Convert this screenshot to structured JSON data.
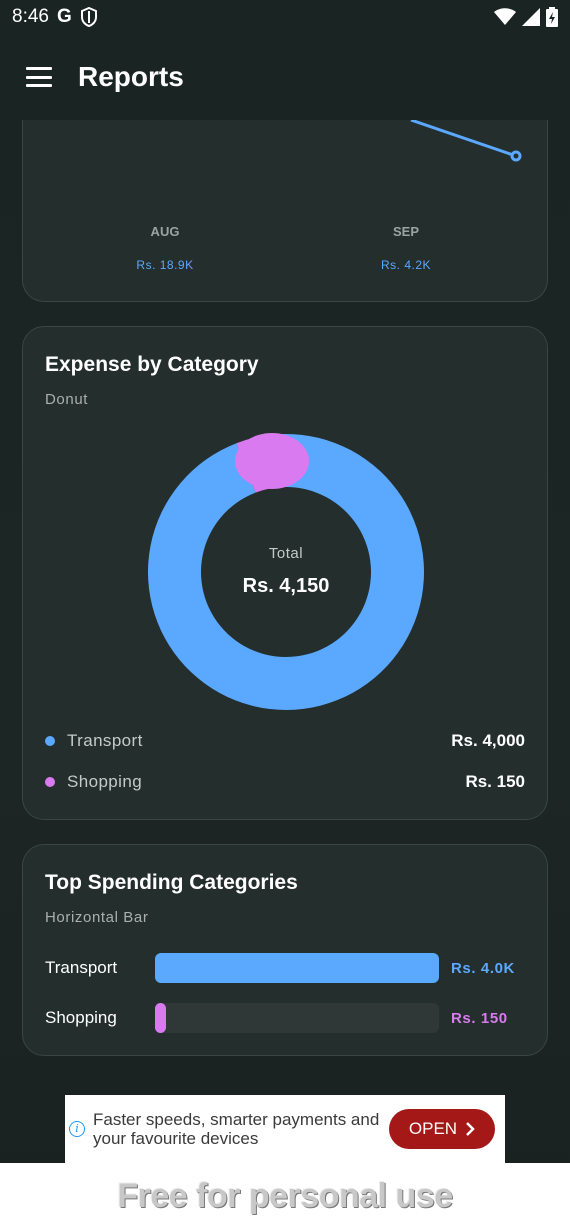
{
  "status_bar": {
    "time": "8:46",
    "g_label": "G"
  },
  "app_bar": {
    "title": "Reports"
  },
  "monthly_chart": {
    "chart_data": {
      "type": "line",
      "categories": [
        "AUG",
        "SEP"
      ],
      "value_labels": [
        "Rs. 18.9K",
        "Rs. 4.2K"
      ],
      "values": [
        18900,
        4200
      ],
      "xlabel": "",
      "ylabel": ""
    }
  },
  "expense_by_category": {
    "title": "Expense by Category",
    "subtitle": "Donut",
    "center_label": "Total",
    "center_value": "Rs. 4,150",
    "chart_data": {
      "type": "pie",
      "categories": [
        "Transport",
        "Shopping"
      ],
      "values": [
        4000,
        150
      ],
      "colors": [
        "#5aa8ff",
        "#d97af0"
      ]
    },
    "legend": [
      {
        "label": "Transport",
        "value": "Rs. 4,000",
        "color": "#5aa8ff"
      },
      {
        "label": "Shopping",
        "value": "Rs. 150",
        "color": "#d97af0"
      }
    ]
  },
  "top_spending": {
    "title": "Top Spending Categories",
    "subtitle": "Horizontal Bar",
    "chart_data": {
      "type": "bar",
      "orientation": "horizontal",
      "categories": [
        "Transport",
        "Shopping"
      ],
      "values": [
        4000,
        150
      ],
      "colors": [
        "#5aa8ff",
        "#d97af0"
      ]
    },
    "bars": [
      {
        "label": "Transport",
        "value_label": "Rs. 4.0K",
        "fraction": 1.0,
        "color": "#5aa8ff"
      },
      {
        "label": "Shopping",
        "value_label": "Rs. 150",
        "fraction": 0.0375,
        "color": "#d97af0"
      }
    ]
  },
  "ad": {
    "text": "Faster speeds, smarter payments and your favourite devices",
    "open_label": "OPEN"
  },
  "footer": {
    "text": "Free for personal use"
  }
}
